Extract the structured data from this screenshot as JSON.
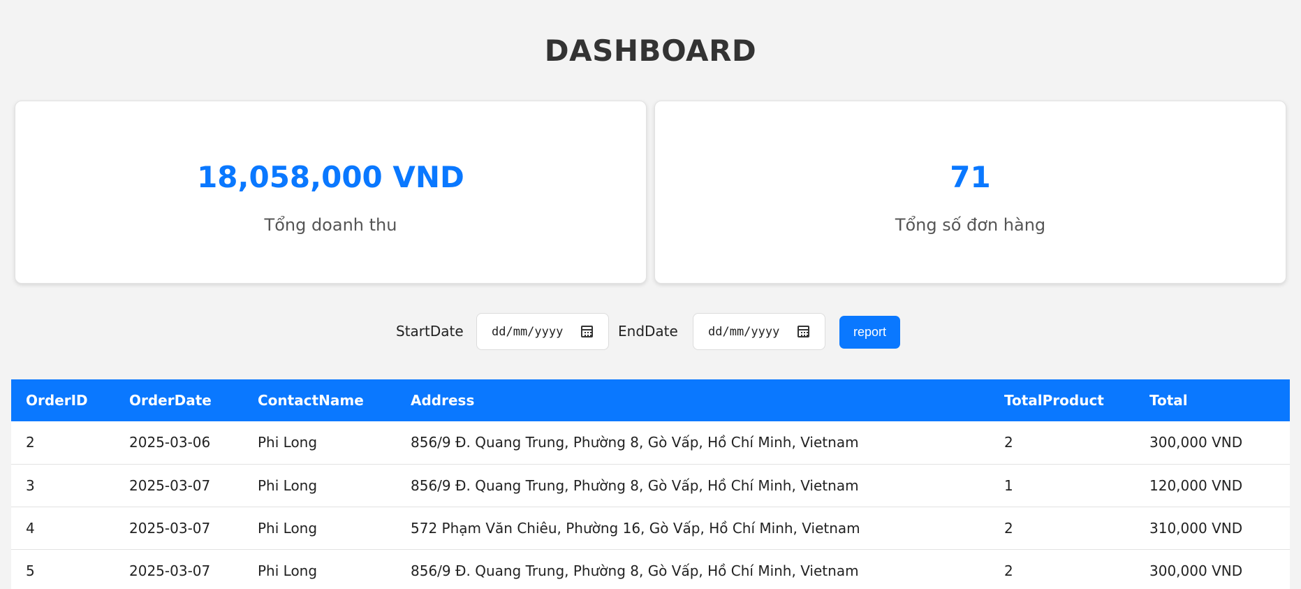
{
  "page": {
    "title": "DASHBOARD"
  },
  "stats": {
    "revenue": {
      "value": "18,058,000 VND",
      "label": "Tổng doanh thu"
    },
    "orders": {
      "value": "71",
      "label": "Tổng số đơn hàng"
    }
  },
  "filter": {
    "start_label": "StartDate",
    "start_placeholder": "dd/mm/yyyy",
    "end_label": "EndDate",
    "end_placeholder": "dd/mm/yyyy",
    "report_label": "report",
    "icon": "calendar-icon"
  },
  "table": {
    "headers": [
      "OrderID",
      "OrderDate",
      "ContactName",
      "Address",
      "TotalProduct",
      "Total"
    ],
    "header_color": "#0a78ff",
    "rows": [
      [
        "2",
        "2025-03-06",
        "Phi Long",
        "856/9 Đ. Quang Trung, Phường 8, Gò Vấp, Hồ Chí Minh, Vietnam",
        "2",
        "300,000 VND"
      ],
      [
        "3",
        "2025-03-07",
        "Phi Long",
        "856/9 Đ. Quang Trung, Phường 8, Gò Vấp, Hồ Chí Minh, Vietnam",
        "1",
        "120,000 VND"
      ],
      [
        "4",
        "2025-03-07",
        "Phi Long",
        "572 Phạm Văn Chiêu, Phường 16, Gò Vấp, Hồ Chí Minh, Vietnam",
        "2",
        "310,000 VND"
      ],
      [
        "5",
        "2025-03-07",
        "Phi Long",
        "856/9 Đ. Quang Trung, Phường 8, Gò Vấp, Hồ Chí Minh, Vietnam",
        "2",
        "300,000 VND"
      ]
    ]
  },
  "colors": {
    "accent": "#0a78ff",
    "background": "#f3f3f3"
  }
}
